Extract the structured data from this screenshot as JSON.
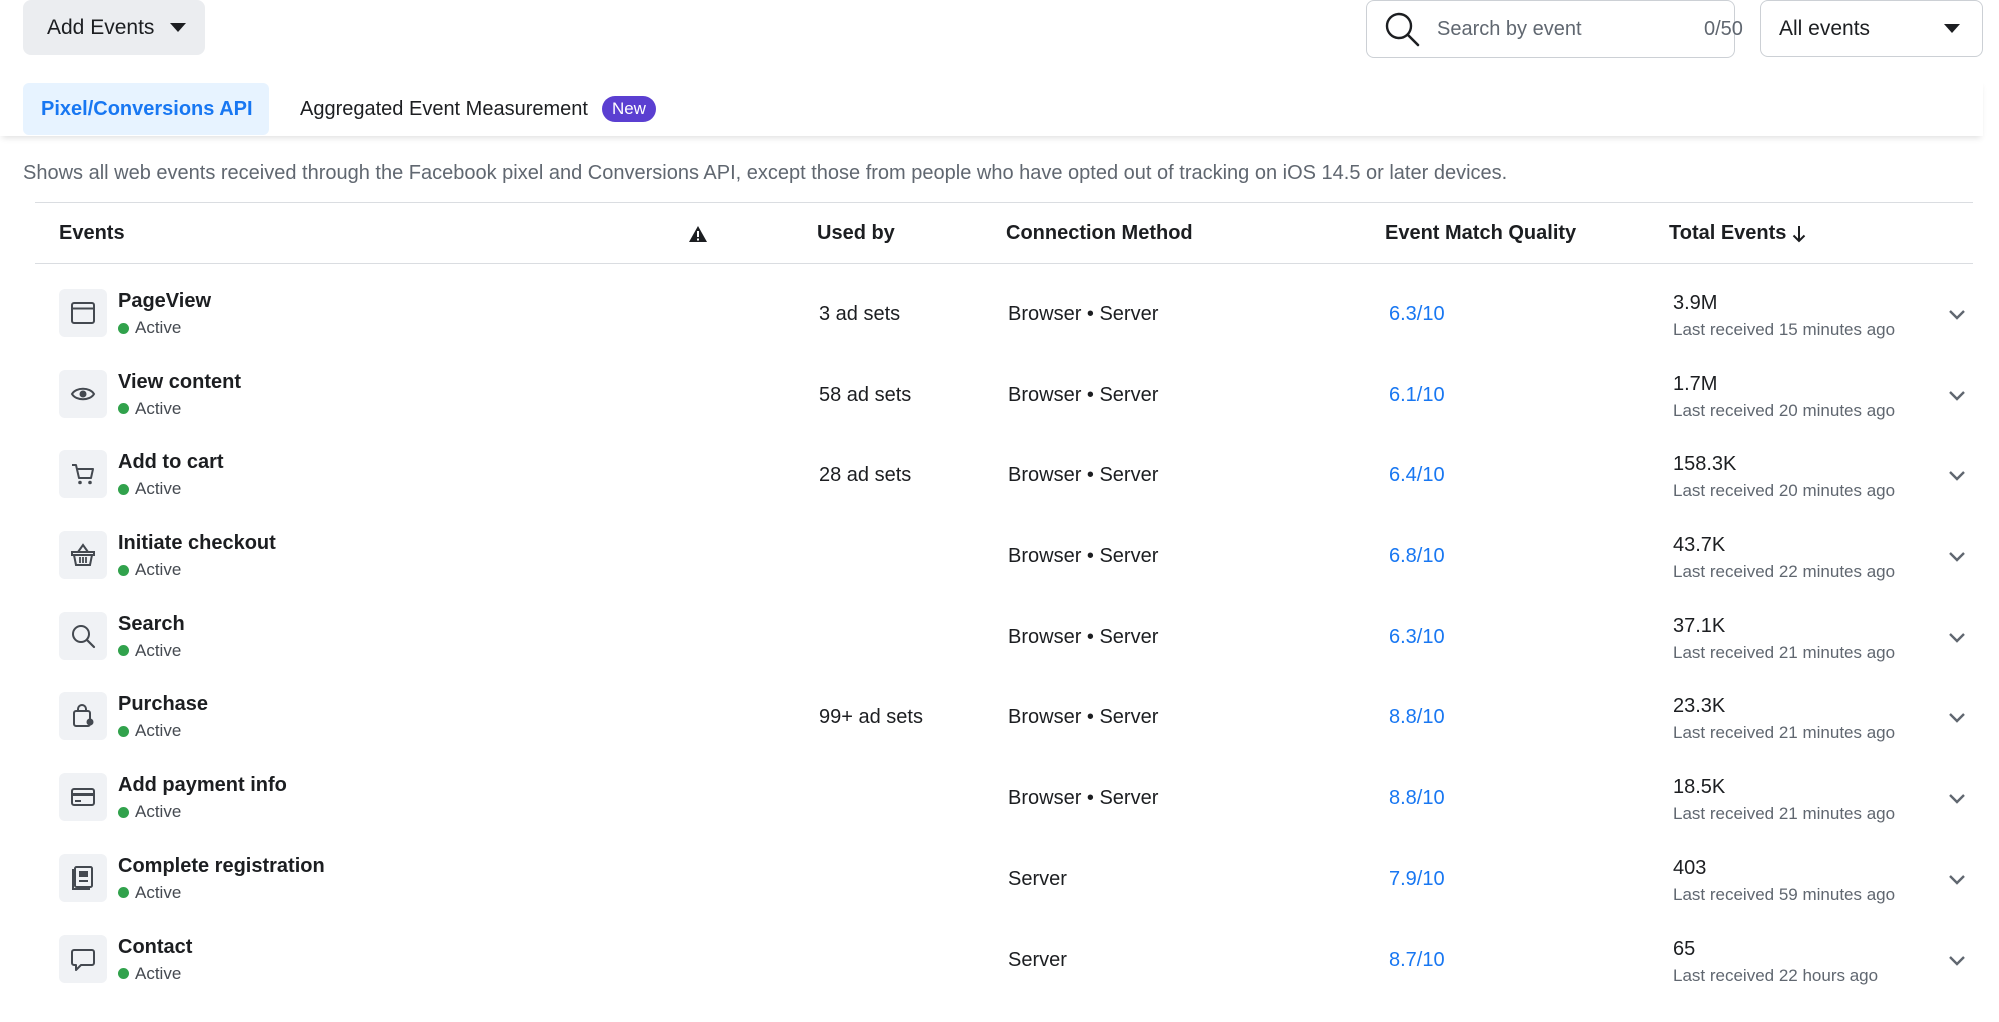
{
  "toolbar": {
    "add_events_label": "Add Events",
    "search_placeholder": "Search by event",
    "search_count": "0/50",
    "filter_value": "All events"
  },
  "tabs": [
    {
      "label": "Pixel/Conversions API",
      "active": true
    },
    {
      "label": "Aggregated Event Measurement",
      "badge": "New",
      "active": false
    }
  ],
  "description": "Shows all web events received through the Facebook pixel and Conversions API, except those from people who have opted out of tracking on iOS 14.5 or later devices.",
  "table": {
    "headers": {
      "events": "Events",
      "used_by": "Used by",
      "connection_method": "Connection Method",
      "event_match_quality": "Event Match Quality",
      "total_events": "Total Events"
    },
    "rows": [
      {
        "icon": "browser-window-icon",
        "name": "PageView",
        "status": "Active",
        "used_by": "3 ad sets",
        "connection": "Browser • Server",
        "emq": "6.3/10",
        "total": "3.9M",
        "last": "Last received 15 minutes ago"
      },
      {
        "icon": "eye-icon",
        "name": "View content",
        "status": "Active",
        "used_by": "58 ad sets",
        "connection": "Browser • Server",
        "emq": "6.1/10",
        "total": "1.7M",
        "last": "Last received 20 minutes ago"
      },
      {
        "icon": "cart-icon",
        "name": "Add to cart",
        "status": "Active",
        "used_by": "28 ad sets",
        "connection": "Browser • Server",
        "emq": "6.4/10",
        "total": "158.3K",
        "last": "Last received 20 minutes ago"
      },
      {
        "icon": "basket-icon",
        "name": "Initiate checkout",
        "status": "Active",
        "used_by": "",
        "connection": "Browser • Server",
        "emq": "6.8/10",
        "total": "43.7K",
        "last": "Last received 22 minutes ago"
      },
      {
        "icon": "search-icon",
        "name": "Search",
        "status": "Active",
        "used_by": "",
        "connection": "Browser • Server",
        "emq": "6.3/10",
        "total": "37.1K",
        "last": "Last received 21 minutes ago"
      },
      {
        "icon": "shopping-bag-icon",
        "name": "Purchase",
        "status": "Active",
        "used_by": "99+ ad sets",
        "connection": "Browser • Server",
        "emq": "8.8/10",
        "total": "23.3K",
        "last": "Last received 21 minutes ago"
      },
      {
        "icon": "credit-card-icon",
        "name": "Add payment info",
        "status": "Active",
        "used_by": "",
        "connection": "Browser • Server",
        "emq": "8.8/10",
        "total": "18.5K",
        "last": "Last received 21 minutes ago"
      },
      {
        "icon": "registration-form-icon",
        "name": "Complete registration",
        "status": "Active",
        "used_by": "",
        "connection": "Server",
        "emq": "7.9/10",
        "total": "403",
        "last": "Last received 59 minutes ago"
      },
      {
        "icon": "chat-bubble-icon",
        "name": "Contact",
        "status": "Active",
        "used_by": "",
        "connection": "Server",
        "emq": "8.7/10",
        "total": "65",
        "last": "Last received 22 hours ago"
      }
    ]
  },
  "colors": {
    "accent": "#1877f2",
    "active_tab_bg": "#e7f3ff",
    "badge": "#5b3fd1",
    "status_active": "#31a24c"
  }
}
